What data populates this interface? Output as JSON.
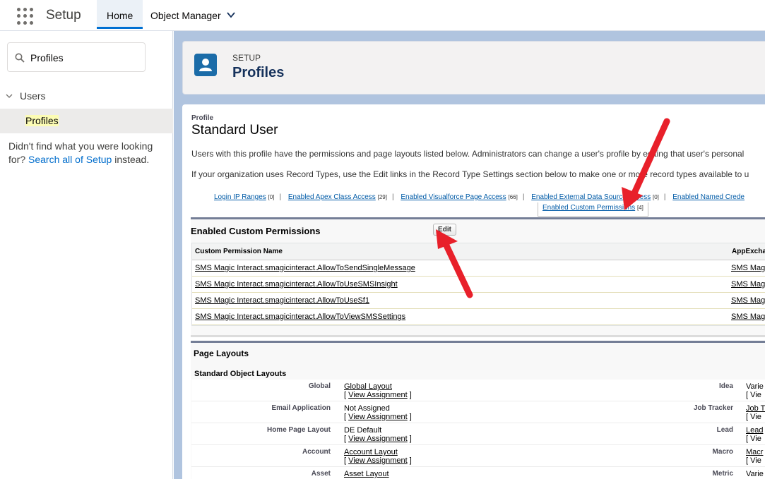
{
  "topbar": {
    "app_name": "Setup",
    "tabs": [
      {
        "label": "Home"
      },
      {
        "label": "Object Manager"
      }
    ]
  },
  "sidebar": {
    "search_value": "Profiles",
    "tree_parent": "Users",
    "tree_child": "Profiles",
    "notfound_text": "Didn't find what you were looking for? ",
    "notfound_link": "Search all of Setup",
    "notfound_tail": " instead."
  },
  "hero": {
    "eyebrow": "SETUP",
    "title": "Profiles"
  },
  "profile": {
    "label": "Profile",
    "name": "Standard User",
    "para1": "Users with this profile have the permissions and page layouts listed below. Administrators can change a user's profile by editing that user's personal",
    "para2": "If your organization uses Record Types, use the Edit links in the Record Type Settings section below to make one or more record types available to u"
  },
  "related_links": {
    "items": [
      {
        "label": "Login IP Ranges",
        "count": "[0]"
      },
      {
        "label": "Enabled Apex Class Access",
        "count": "[29]"
      },
      {
        "label": "Enabled Visualforce Page Access",
        "count": "[66]"
      },
      {
        "label": "Enabled External Data Source Access",
        "count": "[0]"
      },
      {
        "label": "Enabled Named Crede",
        "count": ""
      }
    ],
    "second_row": {
      "label": "Enabled Custom Permissions",
      "count": "[4]"
    }
  },
  "custom_perms": {
    "title": "Enabled Custom Permissions",
    "edit_label": "Edit",
    "col1": "Custom Permission Name",
    "col2": "AppExcha",
    "rows": [
      {
        "name": "SMS Magic Interact.smagicinteract.AllowToSendSingleMessage",
        "app": "SMS Mag"
      },
      {
        "name": "SMS Magic Interact.smagicinteract.AllowToUseSMSInsight",
        "app": "SMS Mag"
      },
      {
        "name": "SMS Magic Interact.smagicinteract.AllowToUseSf1",
        "app": "SMS Mag"
      },
      {
        "name": "SMS Magic Interact.smagicinteract.AllowToViewSMSSettings",
        "app": "SMS Mag"
      }
    ]
  },
  "page_layouts": {
    "title": "Page Layouts",
    "subtitle": "Standard Object Layouts",
    "assign_label": "View Assignment",
    "rows": [
      {
        "label": "Global",
        "value": "Global Layout",
        "linked": true,
        "label2": "Idea",
        "value2": "Varie",
        "assign2": "[ Vie"
      },
      {
        "label": "Email Application",
        "value": "Not Assigned",
        "linked": false,
        "label2": "Job Tracker",
        "value2": "Job T",
        "assign2": "[ Vie"
      },
      {
        "label": "Home Page Layout",
        "value": "DE Default",
        "linked": false,
        "label2": "Lead",
        "value2": "Lead",
        "assign2": "[ Vie"
      },
      {
        "label": "Account",
        "value": "Account Layout",
        "linked": true,
        "label2": "Macro",
        "value2": "Macr",
        "assign2": "[ Vie"
      },
      {
        "label": "Asset",
        "value": "Asset Layout",
        "linked": true,
        "label2": "Metric",
        "value2": "Varie",
        "assign2": ""
      }
    ]
  }
}
